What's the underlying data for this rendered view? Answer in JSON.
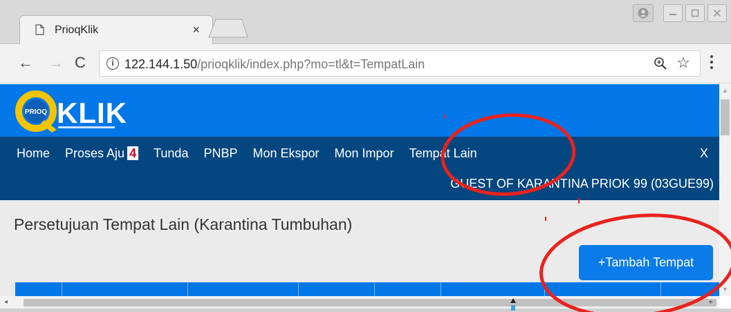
{
  "browser": {
    "tab": {
      "title": "PrioqKlik",
      "close": "×"
    },
    "address_bar": {
      "host": "122.144.1.50",
      "path": "/prioqklik/index.php?mo=tl&t=TempatLain",
      "info": "i"
    },
    "nav": {
      "back": "←",
      "forward": "→",
      "reload": "C"
    },
    "icons": [
      "page-icon",
      "back-arrow-icon",
      "forward-arrow-icon",
      "reload-icon",
      "info-icon",
      "zoom-icon",
      "star-icon",
      "menu-icon",
      "profile-icon",
      "minimize-icon",
      "maximize-icon",
      "close-window-icon"
    ]
  },
  "site": {
    "menu": [
      {
        "label": "Home"
      },
      {
        "label": "Proses Aju",
        "badge": "4"
      },
      {
        "label": "Tunda"
      },
      {
        "label": "PNBP"
      },
      {
        "label": "Mon Ekspor"
      },
      {
        "label": "Mon Impor"
      },
      {
        "label": "Tempat Lain"
      }
    ],
    "close": "X",
    "user": "GUEST OF KARANTINA PRIOK 99 (03GUE99)",
    "page_title": "Persetujuan Tempat Lain (Karantina Tumbuhan)",
    "add_button": "+Tambah Tempat"
  },
  "colors": {
    "brand_blue": "#0277e8",
    "nav_dark": "#04467f",
    "logo_yellow": "#f5c400",
    "badge_red": "#d0021b",
    "annotation_red": "#e8231e"
  }
}
